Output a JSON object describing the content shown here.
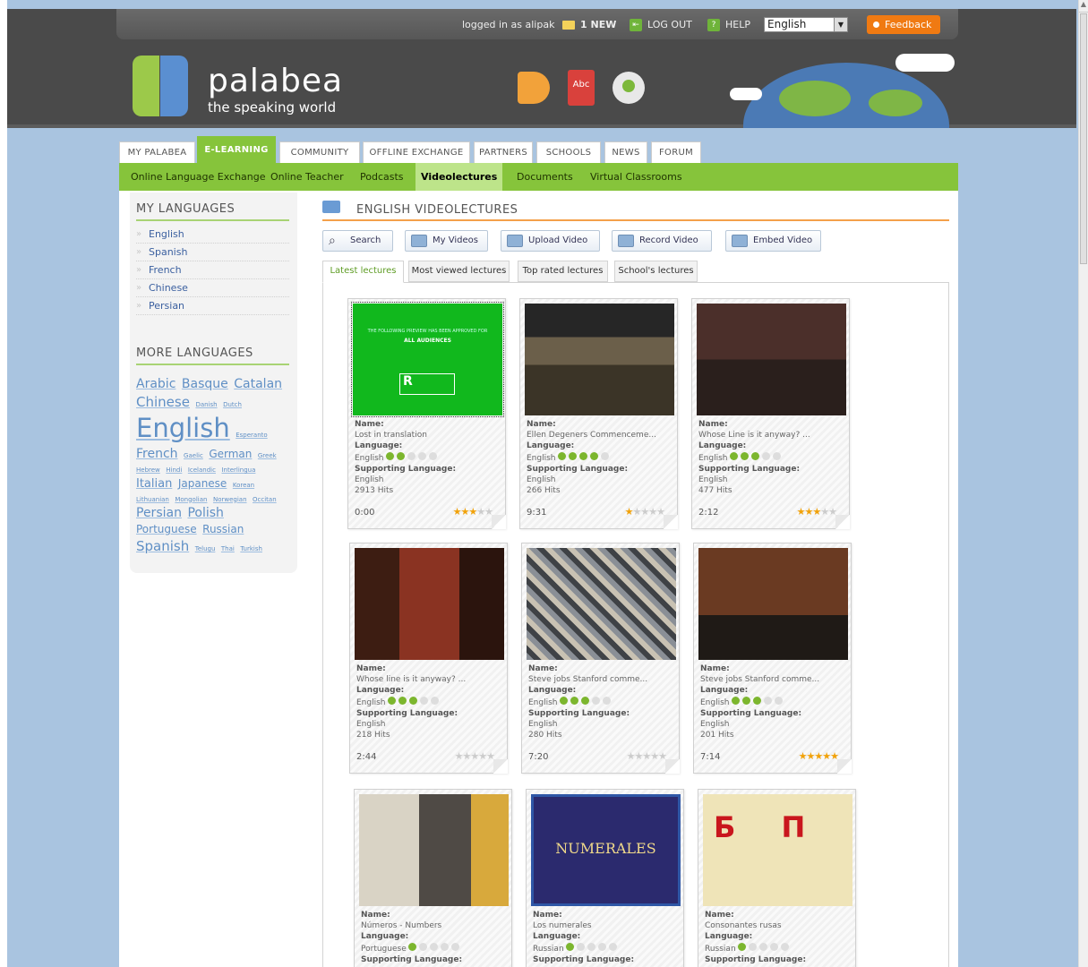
{
  "topbar": {
    "logged_in": "logged in as",
    "username": "alipak",
    "messages": "1 NEW",
    "logout": "LOG OUT",
    "help": "HELP",
    "language": "English",
    "feedback": "Feedback"
  },
  "logo": {
    "name": "palabea",
    "tagline": "the speaking world"
  },
  "header_icons": {
    "book_label": "Abc"
  },
  "nav": {
    "tabs": [
      "MY PALABEA",
      "E-LEARNING",
      "COMMUNITY",
      "OFFLINE EXCHANGE",
      "PARTNERS",
      "SCHOOLS",
      "NEWS",
      "FORUM"
    ],
    "active": "E-LEARNING"
  },
  "subnav": {
    "items": [
      "Online Language Exchange",
      "Online Teacher",
      "Podcasts",
      "Videolectures",
      "Documents",
      "Virtual Classrooms"
    ],
    "active": "Videolectures"
  },
  "sidebar": {
    "my_languages_title": "MY LANGUAGES",
    "my_languages": [
      "English",
      "Spanish",
      "French",
      "Chinese",
      "Persian"
    ],
    "more_languages_title": "MORE LANGUAGES",
    "tag_cloud": [
      {
        "name": "Arabic",
        "size": 14
      },
      {
        "name": "Basque",
        "size": 14
      },
      {
        "name": "Catalan",
        "size": 14
      },
      {
        "name": "Chinese",
        "size": 15
      },
      {
        "name": "Danish",
        "size": 7
      },
      {
        "name": "Dutch",
        "size": 7
      },
      {
        "name": "English",
        "size": 29
      },
      {
        "name": "Esperanto",
        "size": 7
      },
      {
        "name": "French",
        "size": 14
      },
      {
        "name": "Gaelic",
        "size": 7
      },
      {
        "name": "German",
        "size": 12
      },
      {
        "name": "Greek",
        "size": 7
      },
      {
        "name": "Hebrew",
        "size": 7
      },
      {
        "name": "Hindi",
        "size": 7
      },
      {
        "name": "Icelandic",
        "size": 7
      },
      {
        "name": "Interlingua",
        "size": 7
      },
      {
        "name": "Italian",
        "size": 13
      },
      {
        "name": "Japanese",
        "size": 12
      },
      {
        "name": "Korean",
        "size": 7
      },
      {
        "name": "Lithuanian",
        "size": 7
      },
      {
        "name": "Mongolian",
        "size": 7
      },
      {
        "name": "Norwegian",
        "size": 7
      },
      {
        "name": "Occitan",
        "size": 7
      },
      {
        "name": "Persian",
        "size": 14
      },
      {
        "name": "Polish",
        "size": 14
      },
      {
        "name": "Portuguese",
        "size": 12
      },
      {
        "name": "Russian",
        "size": 12
      },
      {
        "name": "Spanish",
        "size": 15
      },
      {
        "name": "Telugu",
        "size": 7
      },
      {
        "name": "Thai",
        "size": 7
      },
      {
        "name": "Turkish",
        "size": 7
      }
    ]
  },
  "main": {
    "title": "ENGLISH VIDEOLECTURES",
    "toolbar": [
      "Search",
      "My Videos",
      "Upload Video",
      "Record Video",
      "Embed Video"
    ],
    "lecture_tabs": [
      "Latest lectures",
      "Most viewed lectures",
      "Top rated lectures",
      "School's lectures"
    ],
    "active_tab": "Latest lectures",
    "labels": {
      "name": "Name:",
      "language": "Language:",
      "supporting": "Supporting Language:"
    },
    "cards": [
      {
        "name": "Lost in translation",
        "language": "English",
        "level": 2,
        "supporting": "English",
        "hits": "2913 Hits",
        "duration": "0:00",
        "rating": 3,
        "thumb": "green",
        "thumb_text": "ALL AUDIENCES",
        "thumb_sub": "THE FOLLOWING PREVIEW HAS BEEN APPROVED FOR"
      },
      {
        "name": "Ellen Degeners Commenceme...",
        "language": "English",
        "level": 4,
        "supporting": "English",
        "hits": "266 Hits",
        "duration": "9:31",
        "rating": 1,
        "thumb": "stage"
      },
      {
        "name": "Whose Line is it anyway? ...",
        "language": "English",
        "level": 3,
        "supporting": "English",
        "hits": "477 Hits",
        "duration": "2:12",
        "rating": 3,
        "thumb": "show"
      },
      {
        "name": "Whose line is it anyway? ...",
        "language": "English",
        "level": 3,
        "supporting": "English",
        "hits": "218 Hits",
        "duration": "2:44",
        "rating": 0,
        "thumb": "red"
      },
      {
        "name": "Steve jobs Stanford comme...",
        "language": "English",
        "level": 3,
        "supporting": "English",
        "hits": "280 Hits",
        "duration": "7:20",
        "rating": 0,
        "thumb": "crowd"
      },
      {
        "name": "Steve jobs Stanford comme...",
        "language": "English",
        "level": 3,
        "supporting": "English",
        "hits": "201 Hits",
        "duration": "7:14",
        "rating": 5,
        "thumb": "speaker"
      },
      {
        "name": "Números - Numbers",
        "language": "Portuguese",
        "level": 1,
        "supporting": "",
        "hits": "",
        "duration": "",
        "rating": -1,
        "thumb": "room"
      },
      {
        "name": "Los numerales",
        "language": "Russian",
        "level": 1,
        "supporting": "",
        "hits": "",
        "duration": "",
        "rating": -1,
        "thumb": "navy",
        "thumb_text": "NUMERALES"
      },
      {
        "name": "Consonantes rusas",
        "language": "Russian",
        "level": 1,
        "supporting": "",
        "hits": "",
        "duration": "",
        "rating": -1,
        "thumb": "cyr",
        "thumb_text": "Б П"
      }
    ]
  }
}
